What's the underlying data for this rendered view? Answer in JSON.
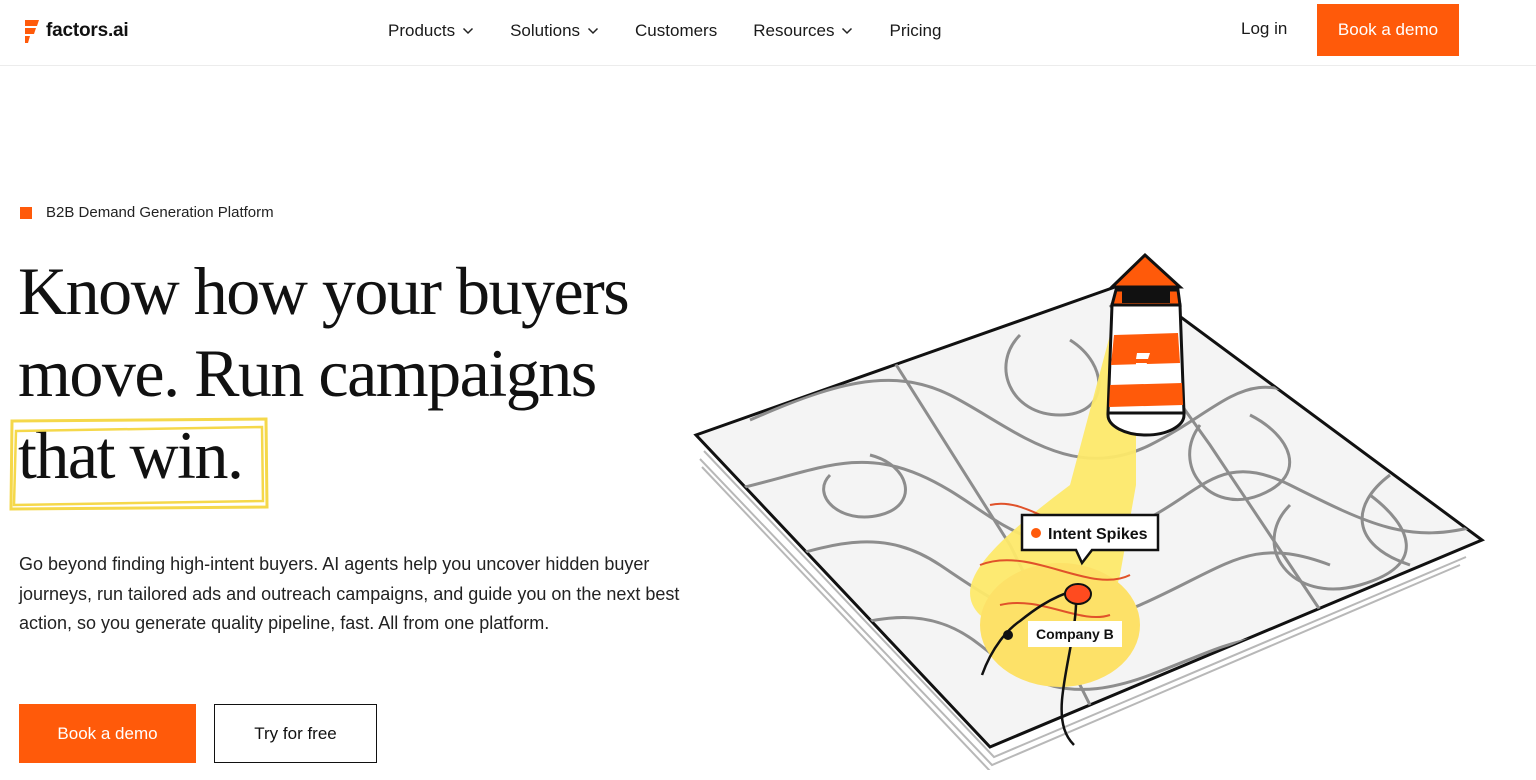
{
  "header": {
    "logo_text": "factors.ai",
    "nav": [
      {
        "label": "Products",
        "has_dropdown": true
      },
      {
        "label": "Solutions",
        "has_dropdown": true
      },
      {
        "label": "Customers",
        "has_dropdown": false
      },
      {
        "label": "Resources",
        "has_dropdown": true
      },
      {
        "label": "Pricing",
        "has_dropdown": false
      }
    ],
    "login_label": "Log in",
    "demo_label": "Book a demo"
  },
  "hero": {
    "eyebrow": "B2B Demand Generation Platform",
    "headline_lines": [
      "Know how your buyers",
      "move. Run campaigns",
      "that win."
    ],
    "subcopy": "Go beyond finding high-intent buyers. AI agents help you uncover hidden buyer journeys, run tailored ads and outreach campaigns, and guide you on the next best action, so you generate quality pipeline, fast. All from one platform.",
    "primary_cta": "Book a demo",
    "secondary_cta": "Try for free"
  },
  "illustration": {
    "tooltip_label": "Intent Spikes",
    "company_label": "Company B"
  },
  "colors": {
    "accent": "#ff5a0a",
    "highlight": "#f5d84a",
    "spotlight": "#fde96a",
    "text": "#111111"
  },
  "icons": [
    "factors-logo-icon",
    "chevron-down-icon"
  ]
}
